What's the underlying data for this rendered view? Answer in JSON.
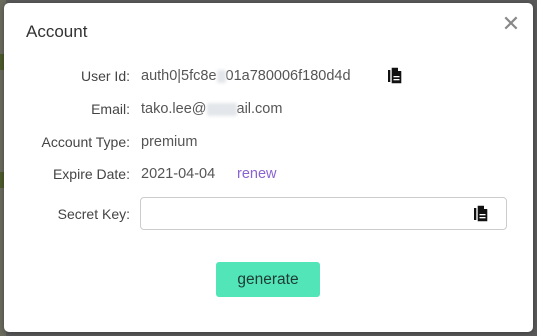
{
  "modal": {
    "title": "Account",
    "close_icon": "✕"
  },
  "fields": {
    "user_id": {
      "label": "User Id:",
      "value_start": "auth0|5fc8e",
      "value_end": "01a780006f180d4d"
    },
    "email": {
      "label": "Email:",
      "value_start": "tako.lee@",
      "value_end": "ail.com"
    },
    "account_type": {
      "label": "Account Type:",
      "value": "premium"
    },
    "expire_date": {
      "label": "Expire Date:",
      "value": "2021-04-04",
      "renew_label": "renew"
    },
    "secret_key": {
      "label": "Secret Key:",
      "value": ""
    }
  },
  "actions": {
    "generate_label": "generate"
  },
  "icons": [
    "close-icon",
    "copy-icon"
  ],
  "colors": {
    "accent_button": "#52e5b8",
    "link": "#8a63d2"
  }
}
